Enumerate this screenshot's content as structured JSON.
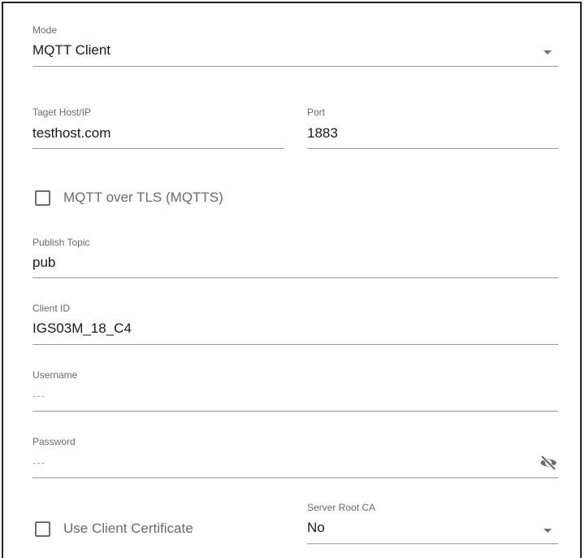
{
  "mode": {
    "label": "Mode",
    "value": "MQTT Client",
    "icon": "dropdown-arrow-icon"
  },
  "target_host": {
    "label": "Taget Host/IP",
    "value": "testhost.com"
  },
  "port": {
    "label": "Port",
    "value": "1883"
  },
  "mqtt_tls": {
    "label": "MQTT over TLS (MQTTS)",
    "checked": false
  },
  "publish_topic": {
    "label": "Publish Topic",
    "value": "pub"
  },
  "client_id": {
    "label": "Client ID",
    "value": "IGS03M_18_C4"
  },
  "username": {
    "label": "Username",
    "placeholder": "---"
  },
  "password": {
    "label": "Password",
    "placeholder": "---",
    "icon": "visibility-off-icon"
  },
  "client_cert": {
    "label": "Use Client Certificate",
    "checked": false
  },
  "server_root_ca": {
    "label": "Server Root CA",
    "value": "No",
    "icon": "dropdown-arrow-icon"
  },
  "colors": {
    "label": "#6b6b6b",
    "text": "#1a1a1a",
    "underline": "#9a9a9a",
    "border": "#222222"
  }
}
